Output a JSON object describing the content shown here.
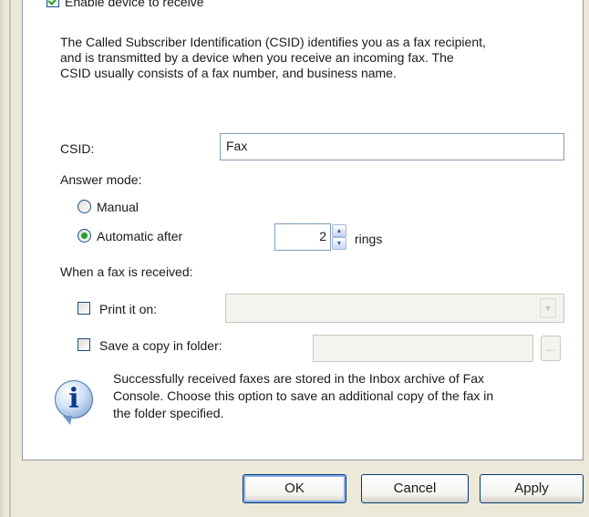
{
  "receive": {
    "enable_label": "Enable device to receive",
    "enable_checked": true,
    "description_lines": [
      "The Called Subscriber Identification (CSID) identifies you as a fax recipient,",
      "and is transmitted by a device when you receive an incoming fax. The",
      "CSID usually consists of a fax number, and business name."
    ]
  },
  "csid": {
    "label": "CSID:",
    "value": "Fax"
  },
  "answer_mode": {
    "label": "Answer mode:",
    "manual_label": "Manual",
    "automatic_label": "Automatic after",
    "selected": "automatic",
    "rings_value": "2",
    "rings_label": "rings"
  },
  "when_received": {
    "label": "When a fax is received:",
    "print_label": "Print it on:",
    "print_checked": false,
    "print_value": "",
    "save_label": "Save a copy in folder:",
    "save_checked": false,
    "folder_value": "",
    "browse_label": "..."
  },
  "info": {
    "icon": "info-icon",
    "lines": [
      "Successfully received faxes are stored in the Inbox archive of Fax",
      "Console. Choose this option to save an additional copy of the fax in",
      "the folder specified."
    ]
  },
  "buttons": {
    "ok": "OK",
    "cancel": "Cancel",
    "apply": "Apply"
  },
  "colors": {
    "dialog_bg": "#ece9d8",
    "panel_bg": "#ffffff",
    "check_green": "#21a121",
    "input_border": "#7f9db9",
    "button_border": "#003c74"
  }
}
